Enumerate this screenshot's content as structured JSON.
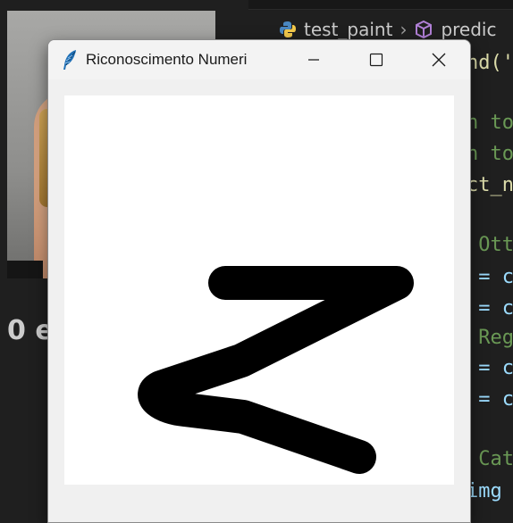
{
  "editor": {
    "breadcrumb": {
      "file": "test_paint",
      "symbol": "predic"
    },
    "code_lines": [
      {
        "text": "nd('",
        "color": "#dcdcaa"
      },
      {
        "text": "n to",
        "color": "#6a9955"
      },
      {
        "text": "n to",
        "color": "#6a9955"
      },
      {
        "text": "ct_n",
        "color": "#dcdcaa"
      },
      {
        "text": " Ott",
        "color": "#6a9955"
      },
      {
        "text": " = c",
        "color": "#9cdcfe"
      },
      {
        "text": " = c",
        "color": "#9cdcfe"
      },
      {
        "text": " Reg",
        "color": "#6a9955"
      },
      {
        "text": " = c",
        "color": "#9cdcfe"
      },
      {
        "text": " = c",
        "color": "#9cdcfe"
      },
      {
        "text": " Cat",
        "color": "#6a9955"
      },
      {
        "text": "img =",
        "color": "#9cdcfe"
      }
    ]
  },
  "left_panel": {
    "text": "0 e"
  },
  "window": {
    "title": "Riconoscimento Numeri",
    "icon": "feather-icon",
    "buttons": {
      "minimize": "minimize-icon",
      "maximize": "maximize-icon",
      "close": "close-icon"
    },
    "canvas": {
      "background": "#ffffff",
      "stroke_color": "#000000",
      "drawn_digit": "2"
    }
  }
}
